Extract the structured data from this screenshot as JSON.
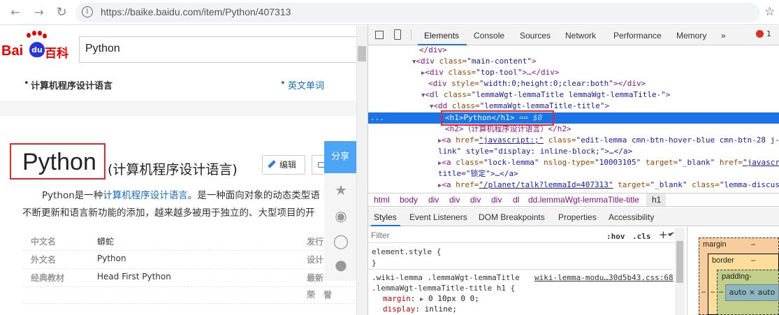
{
  "browser": {
    "url": "https://baike.baidu.com/item/Python/407313",
    "info_icon_glyph": "i"
  },
  "logo": {
    "bai": "Bai",
    "du": "du",
    "baike": "百科"
  },
  "search": {
    "value": "Python"
  },
  "subnav": {
    "bullet": "•",
    "title": "计算机程序设计语言",
    "link": "英文单词"
  },
  "lemma": {
    "title": "Python",
    "subtitle": "(计算机程序设计语言)",
    "edit_label": "编辑",
    "summary_prefix": "Python是一种",
    "summary_link": "计算机程序设计语言",
    "summary_rest": "。是一种面向对象的动态类型语",
    "summary_line2": "不断更新和语言新功能的添加，越来越多被用于独立的、大型项目的开"
  },
  "basic_info": [
    {
      "key": "中文名",
      "value": "蟒蛇",
      "key2": "发行"
    },
    {
      "key": "外文名",
      "value": "Python",
      "key2": "设计"
    },
    {
      "key": "经典教材",
      "value": "Head First Python",
      "key2": "最新"
    },
    {
      "key": "",
      "value": "",
      "key2": "荣　誉"
    }
  ],
  "share": {
    "label": "分享"
  },
  "devtools": {
    "tabs": [
      "Elements",
      "Console",
      "Sources",
      "Network",
      "Performance",
      "Memory",
      "»"
    ],
    "error_count": "1",
    "dom": {
      "l1": "</div>",
      "l2_tag": "<div ",
      "l2_attr": "class=",
      "l2_val": "\"main-content\"",
      "l2_end": ">",
      "l3_tag": "<div ",
      "l3_attr": "class=",
      "l3_val": "\"top-tool\"",
      "l3_end": ">…</div>",
      "l4_tag": "<div ",
      "l4_attr": "style=",
      "l4_val": "\"width:0;height:0;clear:both\"",
      "l4_end": "></div>",
      "l5_tag": "<dl ",
      "l5_attr": "class=",
      "l5_val": "\"lemmaWgt-lemmaTitle lemmaWgt-lemmaTitle-\"",
      "l5_end": ">",
      "l6_tag": "<dd ",
      "l6_attr": "class=",
      "l6_val": "\"lemmaWgt-lemmaTitle-title\"",
      "l6_end": ">",
      "l7_dots": "...",
      "l7": "<h1>Python</h1>",
      "l7_eq": "== $0",
      "l8": "<h2>（计算机程序设计语言）</h2>",
      "l9_tag": "<a ",
      "l9_attr": "href=",
      "l9_val": "\"javascript:;\"",
      "l9_attr2": " class=",
      "l9_val2": "\"edit-lemma cmn-btn-hover-blue cmn-btn-28 j-",
      "l10": "link\" style=\"display: inline-block;\">…</a>",
      "l11_tag": "<a ",
      "l11_attr": "class=",
      "l11_val": "\"lock-lemma\"",
      "l11_attr2": " nslog-type=",
      "l11_val2": "\"10003105\"",
      "l11_attr3": " target=",
      "l11_val3": "\"_blank\"",
      "l11_attr4": " href=",
      "l11_val4": "\"javascr",
      "l12": "title=\"锁定\">…</a>",
      "l13_tag": "<a ",
      "l13_attr": "href=",
      "l13_val": "\"/planet/talk?lemmaId=407313\"",
      "l13_attr2": " target=",
      "l13_val2": "\"_blank\"",
      "l13_attr3": " class=",
      "l13_val3": "\"lemma-discus"
    },
    "breadcrumbs": [
      "html",
      "body",
      "div",
      "div",
      "div",
      "div",
      "dl",
      "dd.lemmaWgt-lemmaTitle-title",
      "h1"
    ],
    "styles_tabs": [
      "Styles",
      "Event Listeners",
      "DOM Breakpoints",
      "Properties",
      "Accessibility"
    ],
    "filter_placeholder": "Filter",
    "hov": ":hov",
    "cls": ".cls",
    "plus": "+",
    "css": {
      "element_style": "element.style {",
      "close": "}",
      "rule_selector1": ".wiki-lemma .lemmaWgt-lemmaTitle",
      "rule_selector2": ".lemmaWgt-lemmaTitle-title h1 {",
      "rule_source": "wiki-lemma-modu…30d5b43.css:68",
      "prop1_name": "margin",
      "prop1_val": "0 10px 0 0;",
      "prop2_name": "display",
      "prop2_val": "inline;"
    },
    "boxmodel": {
      "margin": "margin",
      "border": "border",
      "padding": "padding-",
      "content": "auto × auto",
      "dash": "–"
    }
  }
}
